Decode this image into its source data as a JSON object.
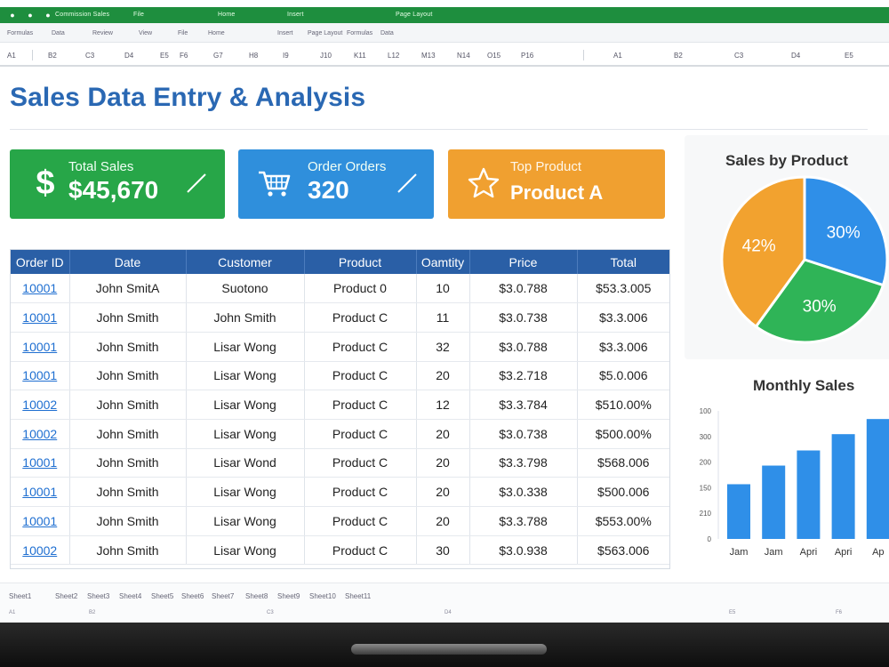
{
  "app": {
    "title_bar": "Commission Sales",
    "menus": [
      "File",
      "Home",
      "Insert",
      "Page Layout",
      "Formulas",
      "Data",
      "Review",
      "View"
    ],
    "formula_cells": [
      "A1",
      "B2",
      "C3",
      "D4",
      "E5",
      "F6",
      "G7",
      "H8",
      "I9",
      "J10",
      "K11",
      "L12",
      "M13",
      "N14",
      "O15",
      "P16"
    ]
  },
  "page": {
    "title": "Sales Data Entry & Analysis"
  },
  "kpis": [
    {
      "label": "Total Sales",
      "value": "$45,670",
      "icon": "dollar-icon",
      "color": "#27a648"
    },
    {
      "label": "Order Orders",
      "value": "320",
      "icon": "cart-icon",
      "color": "#2f8fdc"
    },
    {
      "label": "Top Product",
      "value": "Product A",
      "icon": "star-icon",
      "color": "#f0a030"
    }
  ],
  "table": {
    "columns": [
      "Order ID",
      "Date",
      "Customer",
      "Product",
      "Oamtity",
      "Price",
      "Total"
    ],
    "rows": [
      [
        "10001",
        "John SmitA",
        "Suotono",
        "Product 0",
        "10",
        "$3.0.788",
        "$53.3.005"
      ],
      [
        "10001",
        "John Smith",
        "John Smith",
        "Product C",
        "11",
        "$3.0.738",
        "$3.3.006"
      ],
      [
        "10001",
        "John Smith",
        "Lisar Wong",
        "Product C",
        "32",
        "$3.0.788",
        "$3.3.006"
      ],
      [
        "10001",
        "John Smith",
        "Lisar Wong",
        "Product C",
        "20",
        "$3.2.718",
        "$5.0.006"
      ],
      [
        "10002",
        "John Smith",
        "Lisar Wong",
        "Product C",
        "12",
        "$3.3.784",
        "$510.00%"
      ],
      [
        "10002",
        "John Smith",
        "Lisar Wong",
        "Product C",
        "20",
        "$3.0.738",
        "$500.00%"
      ],
      [
        "10001",
        "John Smith",
        "Lisar Wond",
        "Product C",
        "20",
        "$3.3.798",
        "$568.006"
      ],
      [
        "10001",
        "John Smith",
        "Lisar Wong",
        "Product C",
        "20",
        "$3.0.338",
        "$500.006"
      ],
      [
        "10001",
        "John Smith",
        "Lisar Wong",
        "Product C",
        "20",
        "$3.3.788",
        "$553.00%"
      ],
      [
        "10002",
        "John Smith",
        "Lisar Wong",
        "Product C",
        "30",
        "$3.0.938",
        "$563.006"
      ]
    ]
  },
  "pie": {
    "title": "Sales by Product",
    "slices": [
      {
        "label": "30%",
        "value": 30,
        "color": "#2f8fe8"
      },
      {
        "label": "30%",
        "value": 30,
        "color": "#2fb457"
      },
      {
        "label": "42%",
        "value": 40,
        "color": "#f2a22f"
      }
    ]
  },
  "bars": {
    "title": "Monthly Sales",
    "y_ticks": [
      "100",
      "300",
      "200",
      "150",
      "210",
      "0"
    ],
    "categories": [
      "Jam",
      "Jam",
      "Apri",
      "Apri",
      "Ap"
    ],
    "values": [
      47,
      63,
      76,
      90,
      103
    ],
    "color": "#2f8fe8"
  },
  "status": {
    "items": [
      "Sheet1",
      "Sheet2",
      "Sheet3",
      "Sheet4",
      "Sheet5",
      "Sheet6",
      "Sheet7",
      "Sheet8",
      "Sheet9",
      "Sheet10",
      "Sheet11"
    ]
  }
}
